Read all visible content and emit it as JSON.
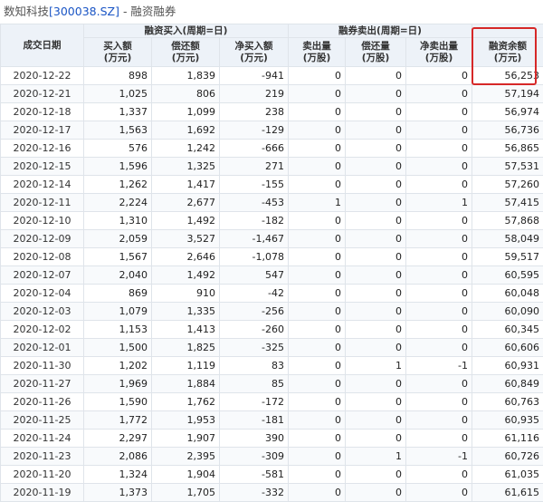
{
  "title": {
    "prefix": "数知科技",
    "link": "[300038.SZ]",
    "suffix": " - 融资融券"
  },
  "headers": {
    "date": "成交日期",
    "group1": "融资买入(周期=日)",
    "group2": "融券卖出(周期=日)",
    "cols": [
      "买入额\n(万元)",
      "偿还额\n(万元)",
      "净买入额\n(万元)",
      "卖出量\n(万股)",
      "偿还量\n(万股)",
      "净卖出量\n(万股)",
      "融资余额\n(万元)"
    ]
  },
  "rows": [
    [
      "2020-12-22",
      "898",
      "1,839",
      "-941",
      "0",
      "0",
      "0",
      "56,253"
    ],
    [
      "2020-12-21",
      "1,025",
      "806",
      "219",
      "0",
      "0",
      "0",
      "57,194"
    ],
    [
      "2020-12-18",
      "1,337",
      "1,099",
      "238",
      "0",
      "0",
      "0",
      "56,974"
    ],
    [
      "2020-12-17",
      "1,563",
      "1,692",
      "-129",
      "0",
      "0",
      "0",
      "56,736"
    ],
    [
      "2020-12-16",
      "576",
      "1,242",
      "-666",
      "0",
      "0",
      "0",
      "56,865"
    ],
    [
      "2020-12-15",
      "1,596",
      "1,325",
      "271",
      "0",
      "0",
      "0",
      "57,531"
    ],
    [
      "2020-12-14",
      "1,262",
      "1,417",
      "-155",
      "0",
      "0",
      "0",
      "57,260"
    ],
    [
      "2020-12-11",
      "2,224",
      "2,677",
      "-453",
      "1",
      "0",
      "1",
      "57,415"
    ],
    [
      "2020-12-10",
      "1,310",
      "1,492",
      "-182",
      "0",
      "0",
      "0",
      "57,868"
    ],
    [
      "2020-12-09",
      "2,059",
      "3,527",
      "-1,467",
      "0",
      "0",
      "0",
      "58,049"
    ],
    [
      "2020-12-08",
      "1,567",
      "2,646",
      "-1,078",
      "0",
      "0",
      "0",
      "59,517"
    ],
    [
      "2020-12-07",
      "2,040",
      "1,492",
      "547",
      "0",
      "0",
      "0",
      "60,595"
    ],
    [
      "2020-12-04",
      "869",
      "910",
      "-42",
      "0",
      "0",
      "0",
      "60,048"
    ],
    [
      "2020-12-03",
      "1,079",
      "1,335",
      "-256",
      "0",
      "0",
      "0",
      "60,090"
    ],
    [
      "2020-12-02",
      "1,153",
      "1,413",
      "-260",
      "0",
      "0",
      "0",
      "60,345"
    ],
    [
      "2020-12-01",
      "1,500",
      "1,825",
      "-325",
      "0",
      "0",
      "0",
      "60,606"
    ],
    [
      "2020-11-30",
      "1,202",
      "1,119",
      "83",
      "0",
      "1",
      "-1",
      "60,931"
    ],
    [
      "2020-11-27",
      "1,969",
      "1,884",
      "85",
      "0",
      "0",
      "0",
      "60,849"
    ],
    [
      "2020-11-26",
      "1,590",
      "1,762",
      "-172",
      "0",
      "0",
      "0",
      "60,763"
    ],
    [
      "2020-11-25",
      "1,772",
      "1,953",
      "-181",
      "0",
      "0",
      "0",
      "60,935"
    ],
    [
      "2020-11-24",
      "2,297",
      "1,907",
      "390",
      "0",
      "0",
      "0",
      "61,116"
    ],
    [
      "2020-11-23",
      "2,086",
      "2,395",
      "-309",
      "0",
      "1",
      "-1",
      "60,726"
    ],
    [
      "2020-11-20",
      "1,324",
      "1,904",
      "-581",
      "0",
      "0",
      "0",
      "61,035"
    ],
    [
      "2020-11-19",
      "1,373",
      "1,705",
      "-332",
      "0",
      "0",
      "0",
      "61,615"
    ]
  ]
}
